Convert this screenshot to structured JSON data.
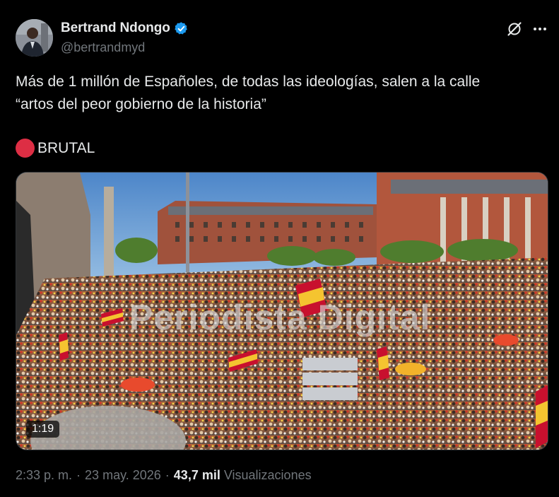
{
  "author": {
    "display_name": "Bertrand Ndongo",
    "handle": "@bertrandmyd",
    "verified": true
  },
  "tweet": {
    "text_lines": [
      "Más de 1 millón de Españoles, de todas las ideologías, salen a la calle",
      "“artos del peor gobierno de la historia”"
    ],
    "emphasis": "BRUTAL",
    "emphasis_emoji": "red-circle"
  },
  "media": {
    "type": "video",
    "duration": "1:19",
    "watermark": "Periodista Digital"
  },
  "meta": {
    "time": "2:33 p. m.",
    "separator": "·",
    "date": "23 may. 2026",
    "views_count": "43,7 mil",
    "views_label": "Visualizaciones"
  },
  "icons": {
    "grok": "grok-icon",
    "more": "more-icon",
    "verified": "verified-badge-icon"
  },
  "colors": {
    "background": "#000000",
    "text": "#e7e9ea",
    "muted": "#71767b",
    "verified_blue": "#1d9bf0",
    "red_circle": "#dd2e44"
  }
}
